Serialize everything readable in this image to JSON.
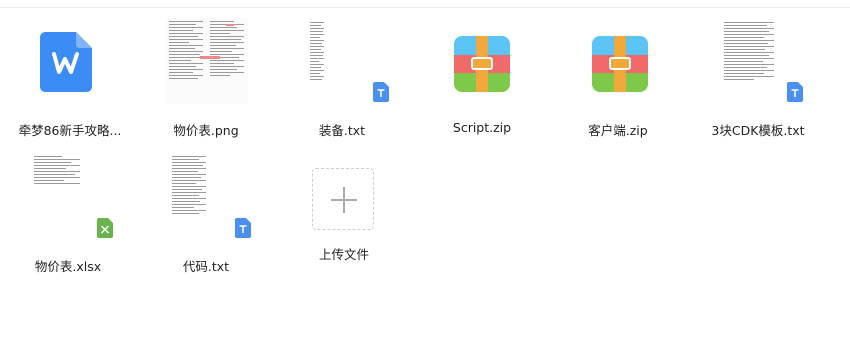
{
  "files": [
    {
      "name": "牵梦86新手攻略...",
      "type": "word-doc"
    },
    {
      "name": "物价表.png",
      "type": "image"
    },
    {
      "name": "装备.txt",
      "type": "text"
    },
    {
      "name": "Script.zip",
      "type": "zip"
    },
    {
      "name": "客户端.zip",
      "type": "zip"
    },
    {
      "name": "3块CDK模板.txt",
      "type": "text"
    },
    {
      "name": "物价表.xlsx",
      "type": "excel"
    },
    {
      "name": "代码.txt",
      "type": "text"
    }
  ],
  "upload": {
    "label": "上传文件"
  },
  "colors": {
    "word_blue": "#3b8cf5",
    "txt_badge_blue": "#4a90f0",
    "excel_green": "#68b34c",
    "zip_top": "#5bc4f4",
    "zip_mid": "#f06a6a",
    "zip_bottom": "#7ec84a",
    "zip_zipper": "#f2a93b"
  }
}
